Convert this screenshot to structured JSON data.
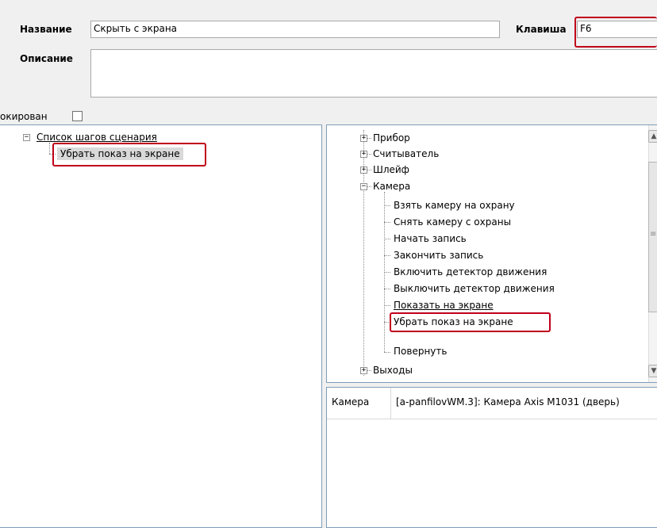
{
  "form": {
    "name_label": "Название",
    "name_value": "Скрыть с экрана",
    "key_label": "Клавиша",
    "key_value": "F6",
    "description_label": "Описание",
    "description_value": "",
    "blocked_label": "окирован",
    "blocked_checked": false
  },
  "left_tree": {
    "root_label": "Список шагов сценария",
    "root_expander": "−",
    "step_label": "Убрать показ на экране"
  },
  "right_tree": {
    "items": [
      {
        "label": "Прибор",
        "expander": "+"
      },
      {
        "label": "Считыватель",
        "expander": "+"
      },
      {
        "label": "Шлейф",
        "expander": "+"
      },
      {
        "label": "Камера",
        "expander": "−"
      },
      {
        "label": "Выходы",
        "expander": "+"
      }
    ],
    "camera_children": [
      "Взять камеру на охрану",
      "Снять камеру с охраны",
      "Начать запись",
      "Закончить запись",
      "Включить детектор движения",
      "Выключить детектор движения",
      "Показать на экране",
      "Убрать показ на экране",
      "Повернуть"
    ],
    "scroll_up": "▲",
    "scroll_down": "▼",
    "scroll_grip": "≡"
  },
  "properties": {
    "key": "Камера",
    "value": "[a-panfilovWM.3]: Камера Axis M1031 (дверь)"
  },
  "colors": {
    "highlight_red": "#c0001a",
    "selected_bg": "#d9d9d9",
    "panel_border": "#7f9db9"
  }
}
